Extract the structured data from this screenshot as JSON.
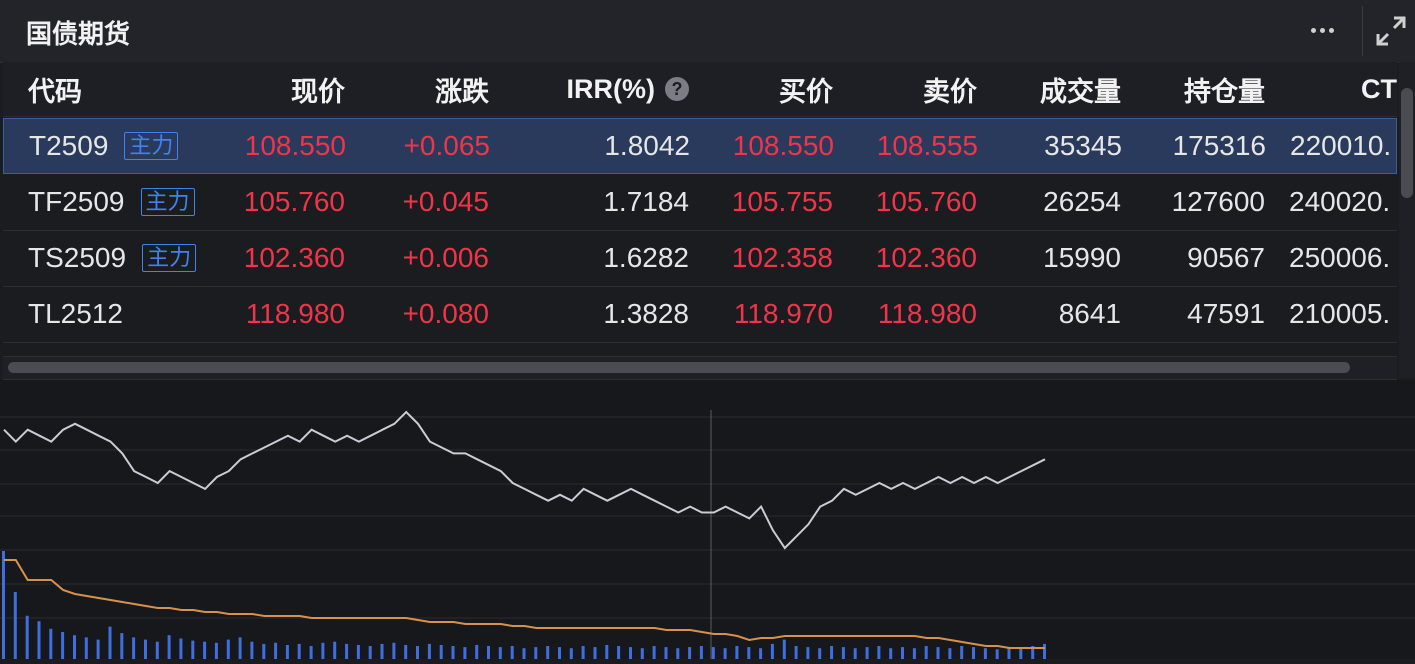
{
  "title": "国债期货",
  "columns": [
    "代码",
    "现价",
    "涨跌",
    "IRR(%)",
    "买价",
    "卖价",
    "成交量",
    "持仓量",
    "CT"
  ],
  "rows": [
    {
      "code": "T2509",
      "tag": "主力",
      "price": "108.550",
      "change": "+0.065",
      "irr": "1.8042",
      "bid": "108.550",
      "ask": "108.555",
      "volume": "35345",
      "oi": "175316",
      "ct": "220010."
    },
    {
      "code": "TF2509",
      "tag": "主力",
      "price": "105.760",
      "change": "+0.045",
      "irr": "1.7184",
      "bid": "105.755",
      "ask": "105.760",
      "volume": "26254",
      "oi": "127600",
      "ct": "240020."
    },
    {
      "code": "TS2509",
      "tag": "主力",
      "price": "102.360",
      "change": "+0.006",
      "irr": "1.6282",
      "bid": "102.358",
      "ask": "102.360",
      "volume": "15990",
      "oi": "90567",
      "ct": "250006."
    },
    {
      "code": "TL2512",
      "tag": "",
      "price": "118.980",
      "change": "+0.080",
      "irr": "1.3828",
      "bid": "118.970",
      "ask": "118.980",
      "volume": "8641",
      "oi": "47591",
      "ct": "210005."
    }
  ],
  "icons": {
    "help": "?",
    "more": "more-icon",
    "expand": "expand-icon"
  },
  "colors": {
    "up": "#f0344a",
    "tag": "#3f82f0",
    "price_line": "#c8ccd4",
    "avg_line": "#d8914a",
    "volume_bar": "#3f6ee0"
  },
  "chart_data": {
    "type": "line",
    "series": [
      {
        "values": [
          108.62,
          108.6,
          108.62,
          108.61,
          108.6,
          108.62,
          108.63,
          108.62,
          108.61,
          108.6,
          108.58,
          108.55,
          108.54,
          108.53,
          108.55,
          108.54,
          108.53,
          108.52,
          108.54,
          108.55,
          108.57,
          108.58,
          108.59,
          108.6,
          108.61,
          108.6,
          108.62,
          108.61,
          108.6,
          108.61,
          108.6,
          108.61,
          108.62,
          108.63,
          108.65,
          108.63,
          108.6,
          108.59,
          108.58,
          108.58,
          108.57,
          108.56,
          108.55,
          108.53,
          108.52,
          108.51,
          108.5,
          108.51,
          108.5,
          108.52,
          108.51,
          108.5,
          108.51,
          108.52,
          108.51,
          108.5,
          108.49,
          108.48,
          108.49,
          108.48,
          108.48,
          108.49,
          108.48,
          108.47,
          108.49,
          108.45,
          108.42,
          108.44,
          108.46,
          108.49,
          108.5,
          108.52,
          108.51,
          108.52,
          108.53,
          108.52,
          108.53,
          108.52,
          108.53,
          108.54,
          108.53,
          108.54,
          108.53,
          108.54,
          108.53,
          108.54,
          108.55,
          108.56,
          108.57
        ]
      }
    ],
    "volume": [
      100,
      62,
      40,
      35,
      28,
      25,
      22,
      20,
      18,
      30,
      24,
      20,
      18,
      16,
      22,
      19,
      17,
      16,
      15,
      18,
      20,
      16,
      14,
      15,
      13,
      14,
      12,
      15,
      16,
      14,
      13,
      12,
      14,
      15,
      13,
      12,
      14,
      13,
      12,
      11,
      13,
      12,
      11,
      12,
      10,
      11,
      12,
      11,
      10,
      12,
      11,
      13,
      12,
      11,
      10,
      12,
      11,
      10,
      11,
      12,
      11,
      10,
      12,
      11,
      10,
      14,
      18,
      12,
      11,
      10,
      12,
      11,
      10,
      11,
      12,
      10,
      11,
      10,
      12,
      11,
      10,
      12,
      11,
      10,
      9,
      10,
      11,
      12,
      14
    ],
    "avg_line": [
      108.57,
      108.57,
      108.56,
      108.56,
      108.56,
      108.555,
      108.553,
      108.552,
      108.551,
      108.55,
      108.549,
      108.548,
      108.547,
      108.546,
      108.546,
      108.545,
      108.545,
      108.544,
      108.544,
      108.543,
      108.543,
      108.543,
      108.542,
      108.542,
      108.542,
      108.542,
      108.541,
      108.541,
      108.541,
      108.541,
      108.541,
      108.541,
      108.541,
      108.541,
      108.541,
      108.54,
      108.539,
      108.539,
      108.539,
      108.538,
      108.538,
      108.538,
      108.538,
      108.537,
      108.537,
      108.536,
      108.536,
      108.536,
      108.536,
      108.536,
      108.536,
      108.536,
      108.536,
      108.536,
      108.536,
      108.536,
      108.535,
      108.535,
      108.535,
      108.534,
      108.533,
      108.533,
      108.532,
      108.53,
      108.531,
      108.531,
      108.532,
      108.532,
      108.532,
      108.532,
      108.532,
      108.532,
      108.532,
      108.532,
      108.532,
      108.532,
      108.532,
      108.532,
      108.531,
      108.531,
      108.53,
      108.529,
      108.528,
      108.527,
      108.527,
      108.526,
      108.526,
      108.526,
      108.526
    ]
  }
}
